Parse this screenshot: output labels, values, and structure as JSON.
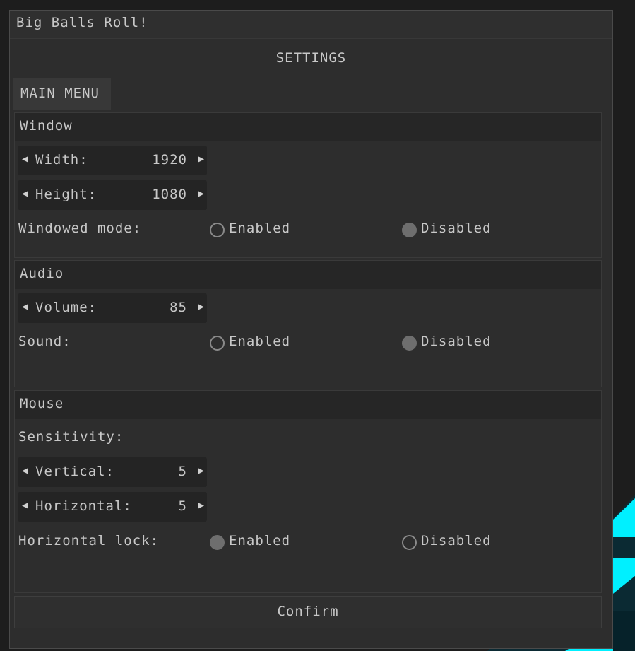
{
  "window": {
    "title": "Big Balls Roll!"
  },
  "heading": "SETTINGS",
  "tab": {
    "label": "MAIN MENU"
  },
  "sections": {
    "window": {
      "title": "Window",
      "width": {
        "label": "Width:",
        "value": "1920"
      },
      "height": {
        "label": "Height:",
        "value": "1080"
      },
      "windowed_mode": {
        "label": "Windowed mode:",
        "enabled": "Enabled",
        "disabled": "Disabled",
        "selected": "Disabled"
      }
    },
    "audio": {
      "title": "Audio",
      "volume": {
        "label": "Volume:",
        "value": "85"
      },
      "sound": {
        "label": "Sound:",
        "enabled": "Enabled",
        "disabled": "Disabled",
        "selected": "Disabled"
      }
    },
    "mouse": {
      "title": "Mouse",
      "sensitivity_label": "Sensitivity:",
      "vertical": {
        "label": "Vertical:",
        "value": "5"
      },
      "horizontal": {
        "label": "Horizontal:",
        "value": "5"
      },
      "horizontal_lock": {
        "label": "Horizontal lock:",
        "enabled": "Enabled",
        "disabled": "Disabled",
        "selected": "Enabled"
      }
    }
  },
  "confirm_label": "Confirm",
  "icons": {
    "decrement": "left-triangle-icon",
    "increment": "right-triangle-icon"
  },
  "colors": {
    "accent_bg": "#00f0ff",
    "panel": "#2d2d2d",
    "text": "#c8c8c8"
  }
}
